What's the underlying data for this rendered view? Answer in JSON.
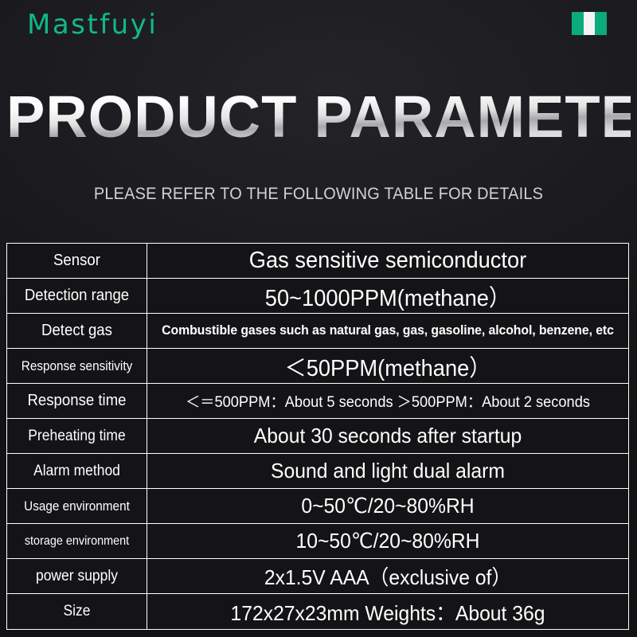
{
  "header": {
    "brand": "Mastfuyi",
    "flag": "nigeria-flag"
  },
  "hero": {
    "title": "PRODUCT PARAMETERS",
    "subtitle": "PLEASE REFER TO THE FOLLOWING TABLE FOR DETAILS"
  },
  "colors": {
    "brand_teal": "#11b88c",
    "flag_green": "#0bab7c",
    "flag_white": "#f4f4f4",
    "background": "#1c1c20",
    "table_border": "#ffffff",
    "text": "#ffffff",
    "subtitle_text": "#d2d2d4"
  },
  "table": {
    "rows": [
      {
        "label": "Sensor",
        "value": "Gas sensitive semiconductor"
      },
      {
        "label": "Detection range",
        "value": "50~1000PPM(methane）"
      },
      {
        "label": "Detect gas",
        "value": "Combustible gases such as natural gas, gas, gasoline, alcohol, benzene, etc"
      },
      {
        "label": "Response sensitivity",
        "value": "＜50PPM(methane）"
      },
      {
        "label": "Response time",
        "value": "＜＝500PPM：About 5 seconds ＞500PPM：About 2 seconds"
      },
      {
        "label": "Preheating time",
        "value": "About 30 seconds after startup"
      },
      {
        "label": "Alarm method",
        "value": "Sound and light dual alarm"
      },
      {
        "label": "Usage environment",
        "value": "0~50℃/20~80%RH"
      },
      {
        "label": "storage environment",
        "value": "10~50℃/20~80%RH"
      },
      {
        "label": "power supply",
        "value": "2x1.5V AAA（exclusive of）"
      },
      {
        "label": "Size",
        "value": "172x27x23mm  Weights：About 36g"
      }
    ]
  }
}
